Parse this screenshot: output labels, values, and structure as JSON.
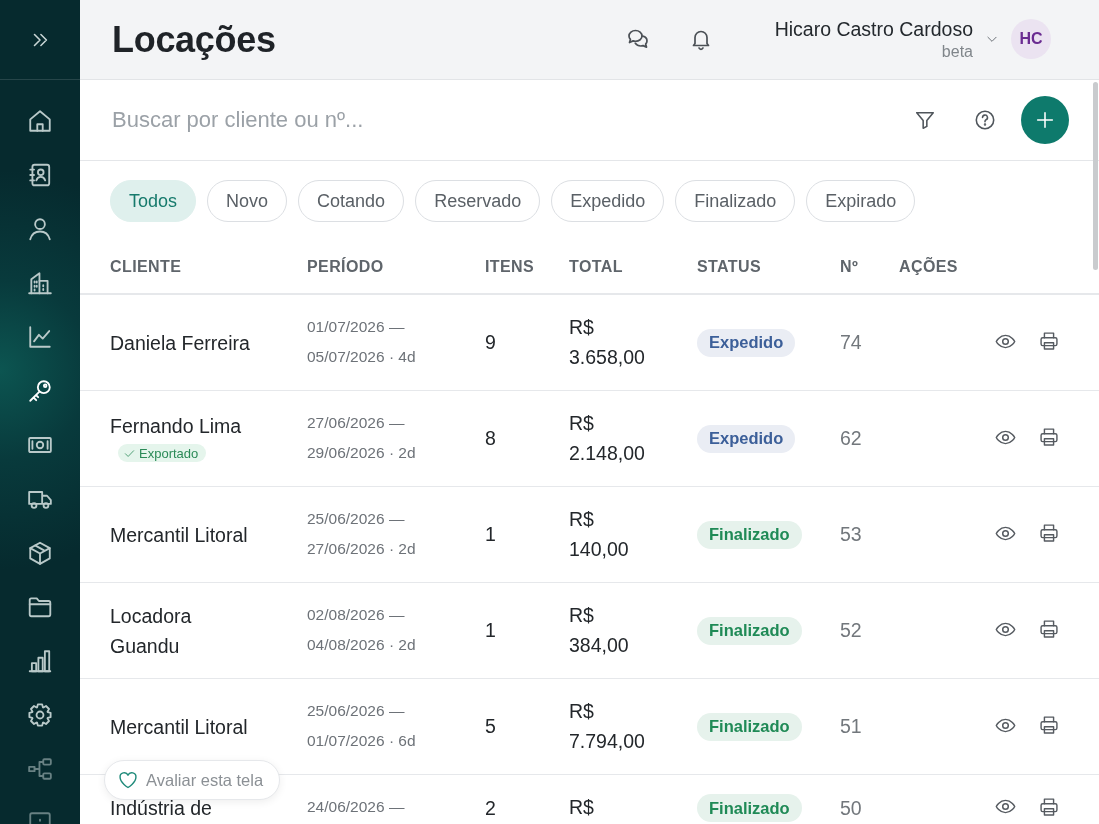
{
  "sidebar": {
    "items": [
      {
        "selected": false
      },
      {
        "selected": false
      },
      {
        "selected": false
      },
      {
        "selected": false
      },
      {
        "selected": false
      },
      {
        "selected": true
      },
      {
        "selected": false
      },
      {
        "selected": false
      },
      {
        "selected": false
      },
      {
        "selected": false
      },
      {
        "selected": false
      },
      {
        "selected": false
      },
      {
        "selected": false
      },
      {
        "selected": false
      }
    ]
  },
  "header": {
    "title": "Locações",
    "user": {
      "name": "Hicaro Castro Cardoso",
      "role": "beta",
      "initials": "HC"
    }
  },
  "search": {
    "placeholder": "Buscar por cliente ou nº..."
  },
  "filters": [
    {
      "label": "Todos",
      "selected": true
    },
    {
      "label": "Novo",
      "selected": false
    },
    {
      "label": "Cotando",
      "selected": false
    },
    {
      "label": "Reservado",
      "selected": false
    },
    {
      "label": "Expedido",
      "selected": false
    },
    {
      "label": "Finalizado",
      "selected": false
    },
    {
      "label": "Expirado",
      "selected": false
    }
  ],
  "table": {
    "columns": [
      "CLIENTE",
      "PERÍODO",
      "ITENS",
      "TOTAL",
      "STATUS",
      "Nº",
      "AÇÕES"
    ],
    "rows": [
      {
        "client": "Daniela Ferreira",
        "period": "01/07/2026 — 05/07/2026 · 4d",
        "items": "9",
        "total": "R$ 3.658,00",
        "status": {
          "label": "Expedido",
          "color": "#3c5f99"
        },
        "number": "74"
      },
      {
        "client": "Fernando Lima",
        "tag": "Exportado",
        "period": "27/06/2026 — 29/06/2026 · 2d",
        "items": "8",
        "total": "R$ 2.148,00",
        "status": {
          "label": "Expedido",
          "color": "#3c5f99"
        },
        "number": "62"
      },
      {
        "client": "Mercantil Litoral",
        "period": "25/06/2026 — 27/06/2026 · 2d",
        "items": "1",
        "total": "R$ 140,00",
        "status": {
          "label": "Finalizado",
          "color": "#1f8a56"
        },
        "number": "53"
      },
      {
        "client": "Locadora Guandu",
        "period": "02/08/2026 — 04/08/2026 · 2d",
        "items": "1",
        "total": "R$ 384,00",
        "status": {
          "label": "Finalizado",
          "color": "#1f8a56"
        },
        "number": "52"
      },
      {
        "client": "Mercantil Litoral",
        "period": "25/06/2026 — 01/07/2026 · 6d",
        "items": "5",
        "total": "R$ 7.794,00",
        "status": {
          "label": "Finalizado",
          "color": "#1f8a56"
        },
        "number": "51"
      },
      {
        "client": "Indústria de",
        "period": "24/06/2026 —",
        "items": "2",
        "total": "R$",
        "status": {
          "label": "Finalizado",
          "color": "#1f8a56"
        },
        "number": "50"
      }
    ]
  },
  "feedback": {
    "label": "Avaliar esta tela"
  }
}
